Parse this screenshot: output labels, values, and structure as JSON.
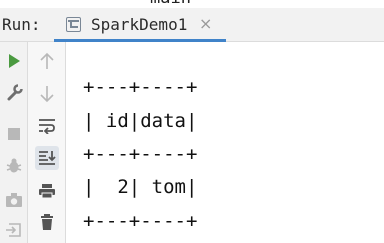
{
  "run_tool_window": {
    "run_label": "Run:",
    "tab": {
      "title": "SparkDemo1",
      "close_glyph": "×"
    },
    "above_text": "main"
  },
  "left_toolbar": {
    "icons": [
      "run-icon",
      "wrench-icon",
      "stop-icon",
      "debug-icon",
      "camera-icon",
      "exit-icon"
    ]
  },
  "side_toolbar": {
    "icons": [
      "scroll-up-icon",
      "scroll-down-icon",
      "soft-wrap-icon",
      "scroll-to-end-icon",
      "print-icon",
      "clear-all-icon"
    ]
  },
  "console": {
    "lines": [
      "+---+----+",
      "| id|data|",
      "+---+----+",
      "|  2| tom|",
      "+---+----+"
    ]
  },
  "colors": {
    "run_green": "#4a9a40",
    "tab_underline": "#4083c9",
    "icon_gray": "#6e6e6e",
    "icon_disabled": "#b8b8b8"
  }
}
